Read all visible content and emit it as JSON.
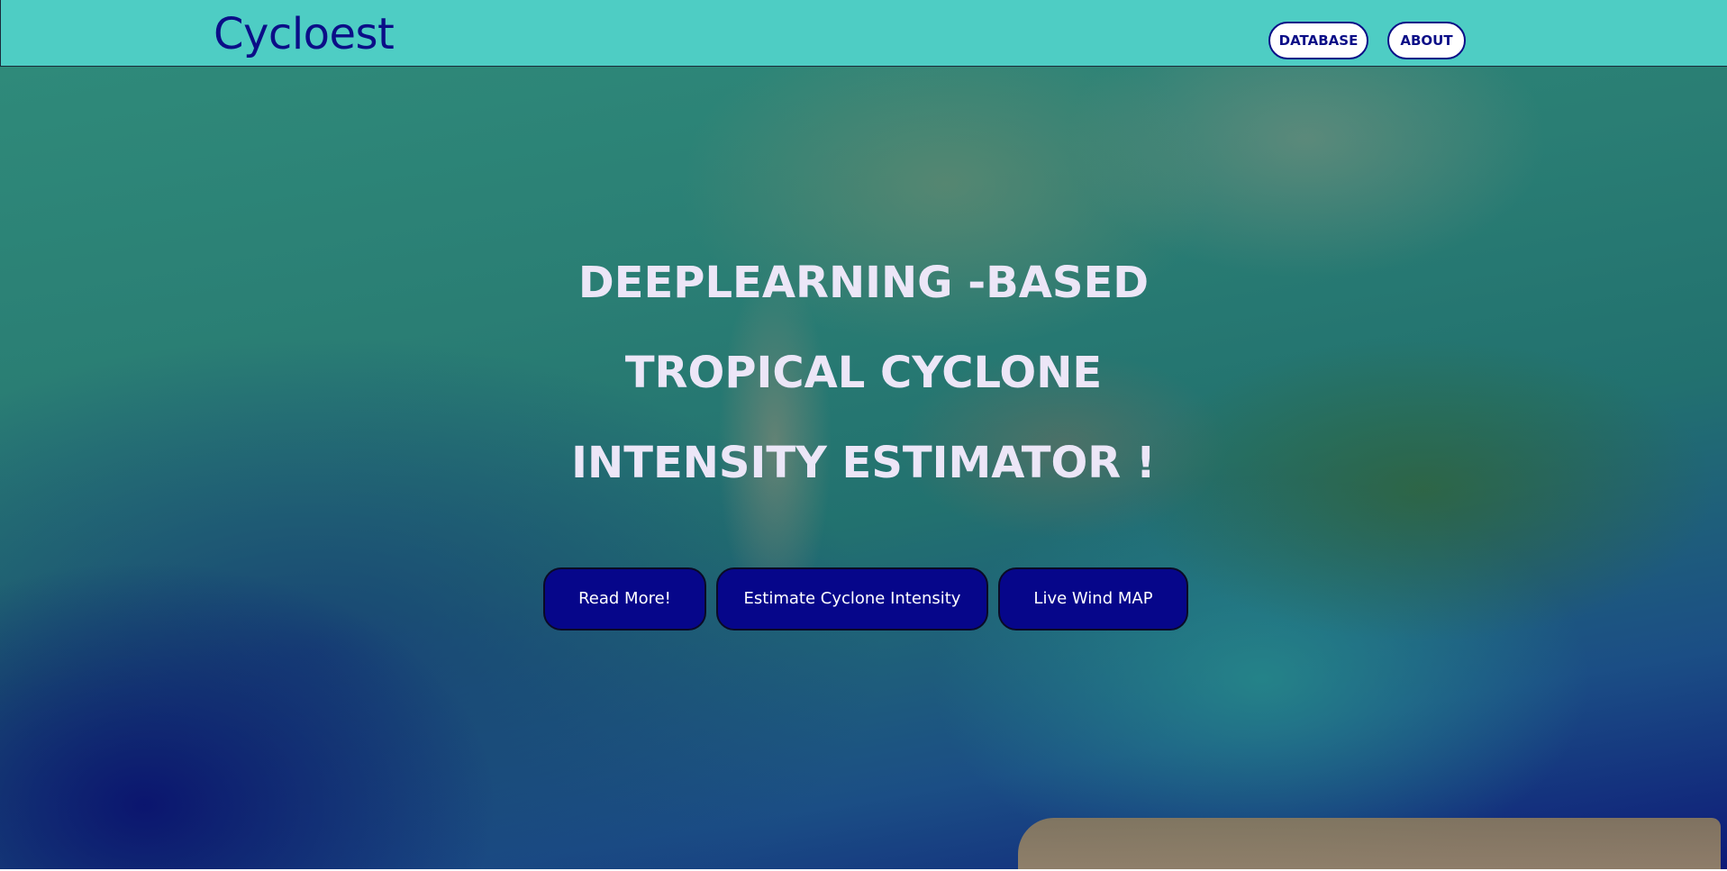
{
  "navbar": {
    "brand": "Cycloest",
    "links": [
      "DATABASE",
      "ABOUT"
    ]
  },
  "hero": {
    "title_lines": [
      "DEEPLEARNING -BASED",
      "TROPICAL CYCLONE",
      "INTENSITY ESTIMATOR !"
    ],
    "buttons": [
      "Read More!",
      "Estimate Cyclone Intensity",
      "Live Wind MAP"
    ]
  },
  "colors": {
    "navbar_bg": "#4ecdc4",
    "brand_text": "#0b0e87",
    "button_bg": "#06068a",
    "hero_text": "#ece6f7"
  }
}
